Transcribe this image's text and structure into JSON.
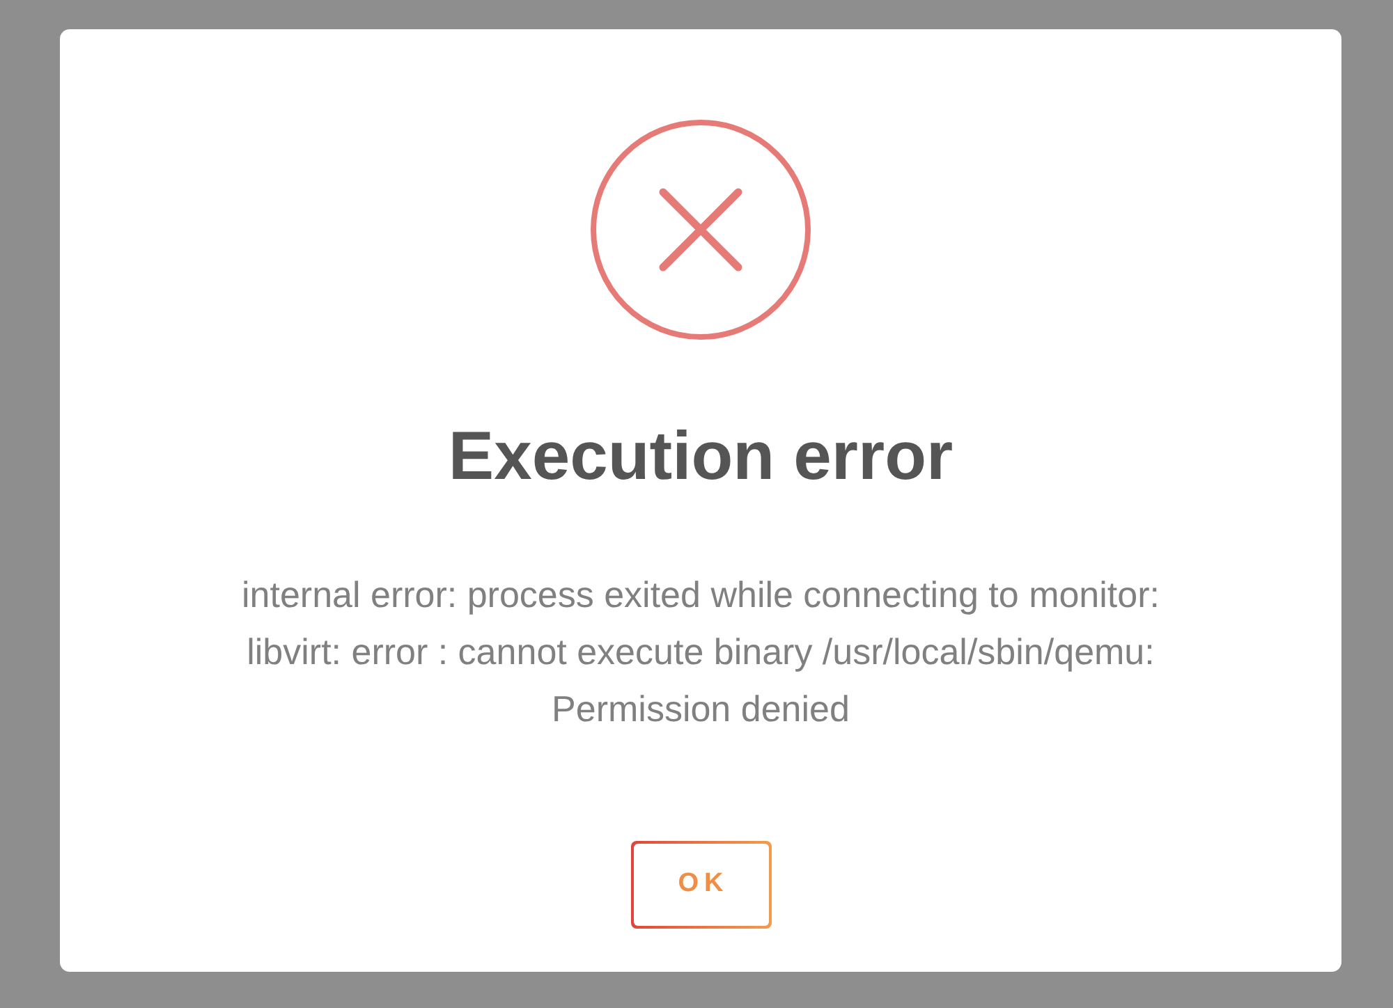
{
  "dialog": {
    "title": "Execution error",
    "message": "internal error: process exited while connecting to monitor:\nlibvirt: error : cannot execute binary /usr/local/sbin/qemu:\nPermission denied",
    "buttons": [
      {
        "label": "OK"
      }
    ]
  }
}
